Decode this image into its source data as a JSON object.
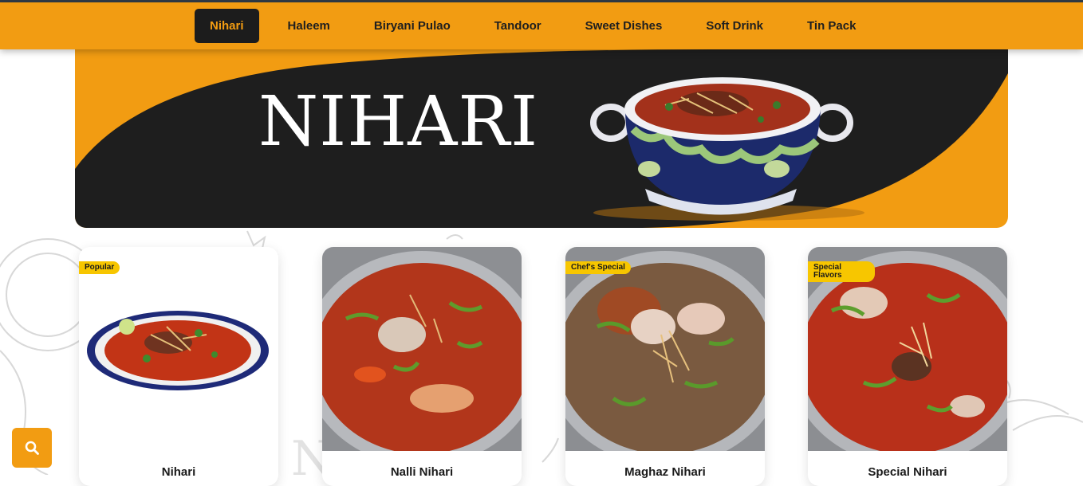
{
  "nav": {
    "items": [
      "Nihari",
      "Haleem",
      "Biryani Pulao",
      "Tandoor",
      "Sweet Dishes",
      "Soft Drink",
      "Tin Pack"
    ],
    "active": "Nihari"
  },
  "banner": {
    "title": "NIHARI"
  },
  "cards": [
    {
      "name": "Nihari",
      "badge": "Popular"
    },
    {
      "name": "Nalli Nihari",
      "badge": ""
    },
    {
      "name": "Maghaz Nihari",
      "badge": "Chef's Special"
    },
    {
      "name": "Special Nihari",
      "badge": "Special Flavors"
    }
  ],
  "colors": {
    "accent": "#f29c12",
    "dark": "#1c1c1c",
    "badge": "#f7c600"
  },
  "icons": {
    "search": "search-icon"
  }
}
